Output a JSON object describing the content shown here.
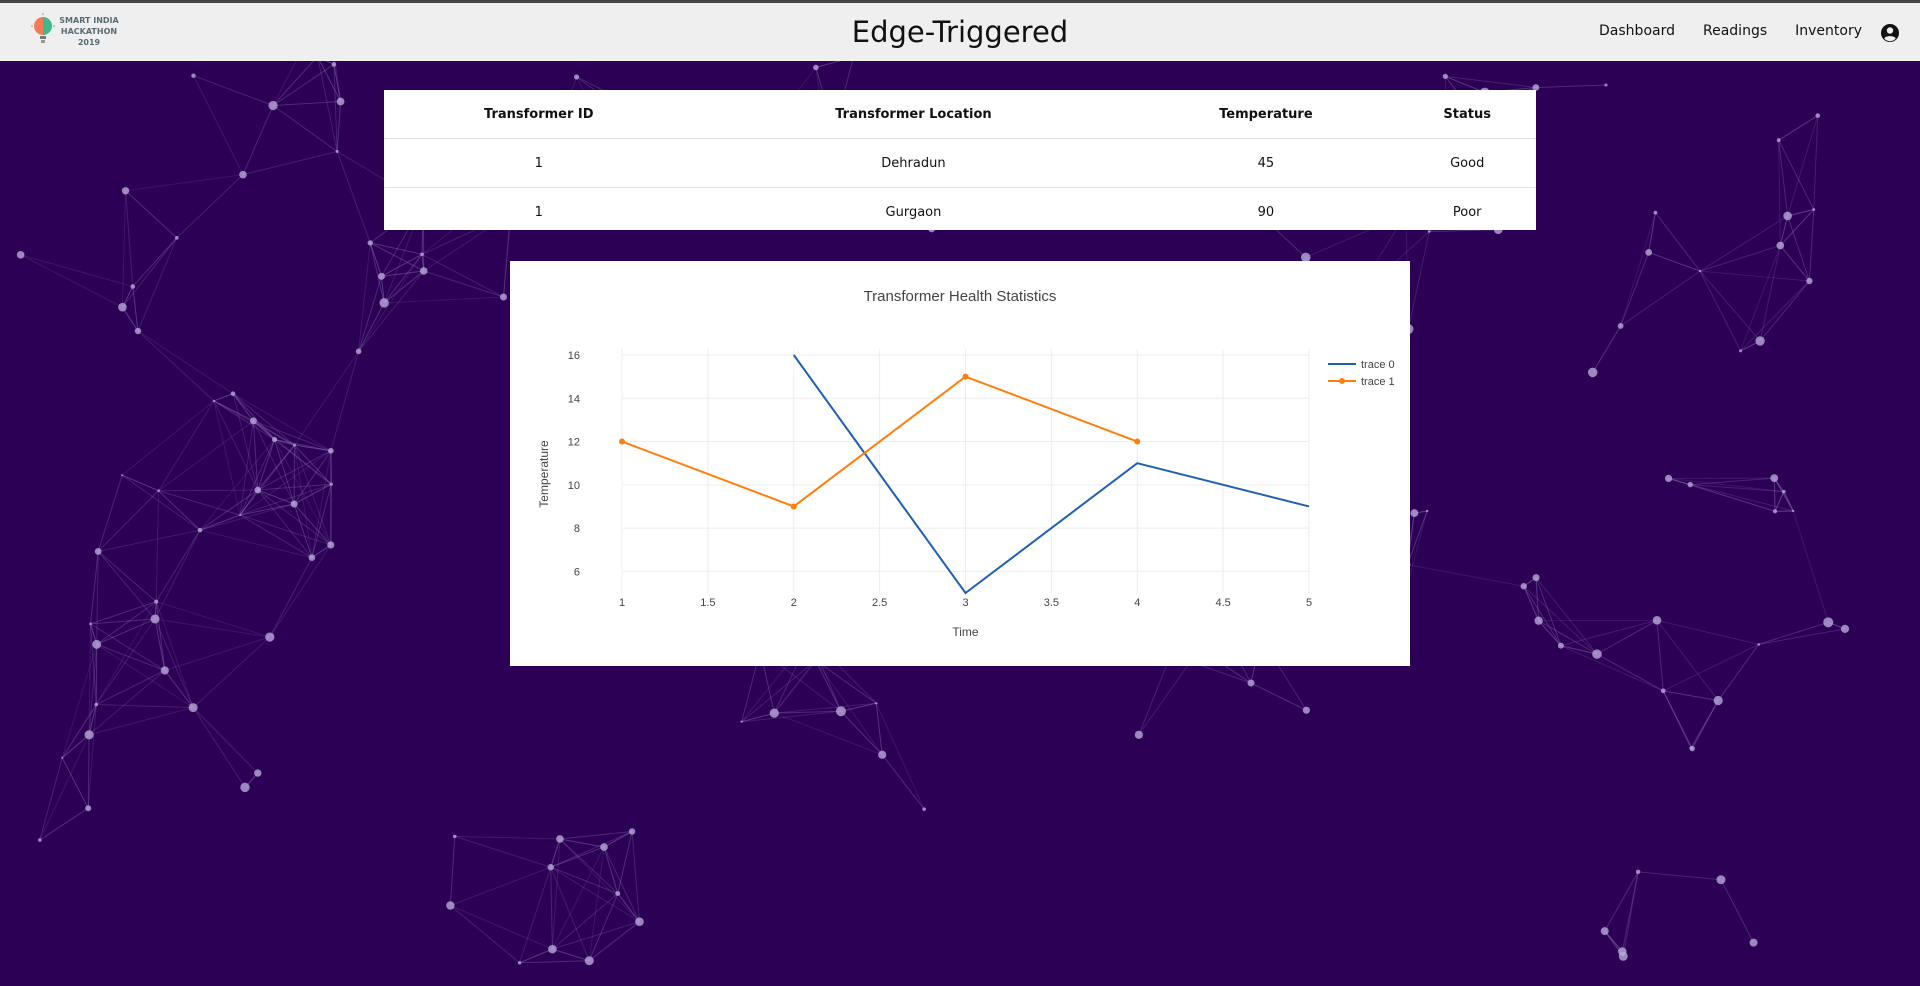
{
  "header": {
    "logo": {
      "line1": "SMART INDIA",
      "line2": "HACKATHON",
      "line3": "2019"
    },
    "title": "Edge-Triggered",
    "nav": [
      "Dashboard",
      "Readings",
      "Inventory"
    ],
    "account_icon": "account-circle-icon"
  },
  "table": {
    "headers": [
      "Transformer ID",
      "Transformer Location",
      "Temperature",
      "Status"
    ],
    "rows": [
      [
        "1",
        "Dehradun",
        "45",
        "Good"
      ],
      [
        "1",
        "Gurgaon",
        "90",
        "Poor"
      ]
    ]
  },
  "chart_data": {
    "type": "line",
    "title": "Transformer Health Statistics",
    "xlabel": "Time",
    "ylabel": "Temperature",
    "xlim": [
      1,
      5
    ],
    "ylim": [
      5,
      16
    ],
    "x_ticks": [
      1,
      1.5,
      2,
      2.5,
      3,
      3.5,
      4,
      4.5,
      5
    ],
    "y_ticks": [
      6,
      8,
      10,
      12,
      14,
      16
    ],
    "grid": true,
    "legend_position": "right",
    "series": [
      {
        "name": "trace 0",
        "color": "#1f5fb4",
        "mode": "lines",
        "x": [
          2,
          3,
          4,
          5
        ],
        "y": [
          16,
          5,
          11,
          9
        ]
      },
      {
        "name": "trace 1",
        "color": "#ff7f0e",
        "mode": "lines+markers",
        "x": [
          1,
          2,
          3,
          4
        ],
        "y": [
          12,
          9,
          15,
          12
        ]
      }
    ]
  },
  "colors": {
    "background": "#2c0055",
    "navbar": "#efefef",
    "network": "#9a82c6"
  }
}
